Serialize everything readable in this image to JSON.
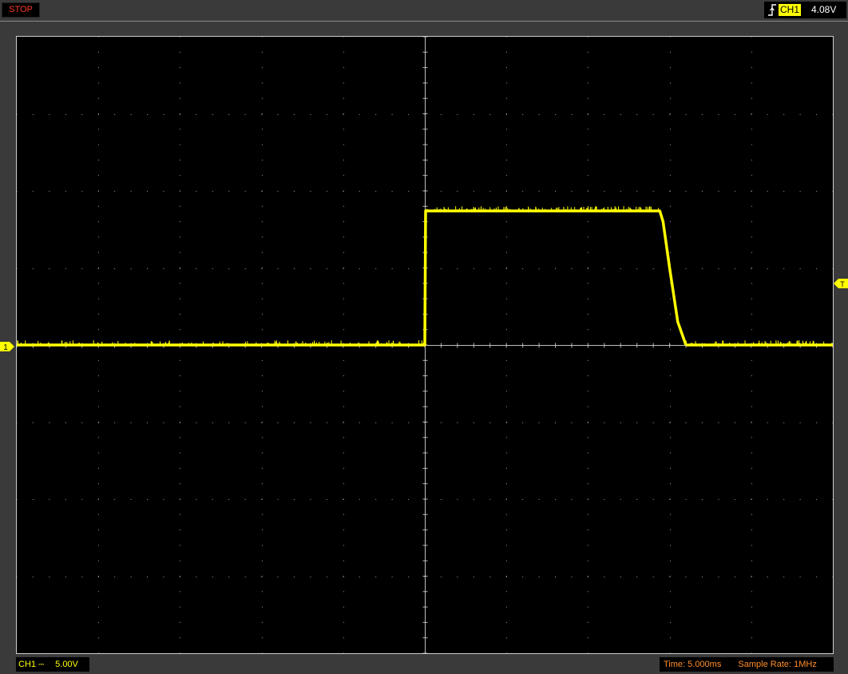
{
  "status": {
    "run_state": "STOP",
    "run_state_color": "#ff3a2a"
  },
  "trigger": {
    "edge_icon": "rising-edge-icon",
    "channel": "CH1",
    "level": "4.08V",
    "marker_label": "T"
  },
  "channel1": {
    "marker_label": "1",
    "name": "CH1",
    "coupling_icon": "dc-coupling-icon",
    "coupling_glyph": "⎓",
    "volts_per_div": "5.00V",
    "trace_color": "#ffff00"
  },
  "acquisition": {
    "time_label": "Time: 5.000ms",
    "sample_rate_label": "Sample Rate: 1MHz",
    "info_color": "#ff8c2a"
  },
  "chart_data": {
    "type": "line",
    "x_divisions": 10,
    "y_divisions": 8,
    "volts_per_div": 5.0,
    "time_per_div_ms": 5.0,
    "x_range_ms": [
      -25,
      25
    ],
    "y_range_V": [
      -20,
      20
    ],
    "grid": true,
    "series": [
      {
        "x_ms": [
          -25,
          0,
          0.05,
          14.4,
          14.6,
          15.0,
          15.5,
          16.0
        ],
        "y_V": [
          0,
          0,
          8.7,
          8.7,
          8.0,
          5.0,
          1.5,
          0
        ]
      },
      {
        "x_ms": [
          16.0,
          25
        ],
        "y_V": [
          0,
          0
        ]
      }
    ]
  }
}
